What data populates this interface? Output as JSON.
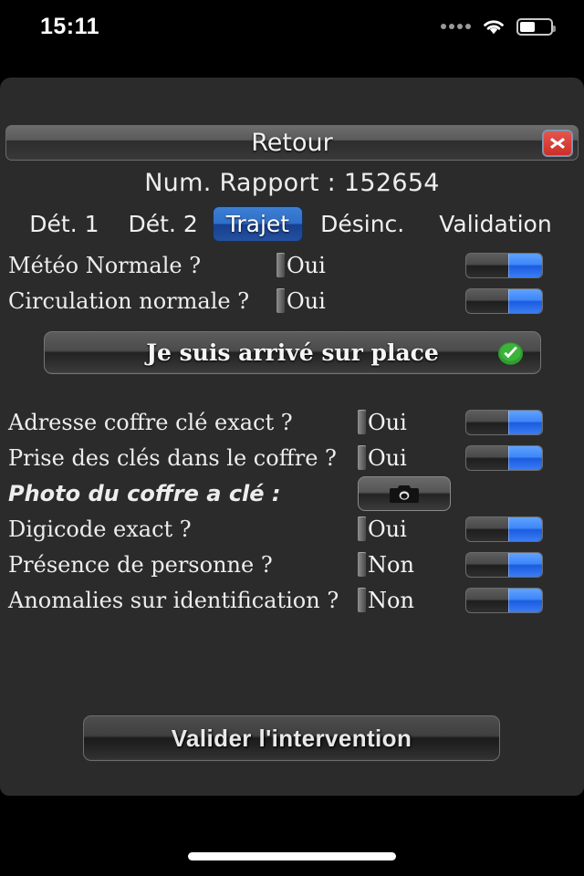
{
  "statusbar": {
    "time": "15:11",
    "signal_icon": "signal-dots-icon",
    "wifi_icon": "wifi-icon",
    "battery_icon": "battery-icon"
  },
  "header": {
    "back_label": "Retour",
    "close_icon": "close-x-icon",
    "report_label": "Num. Rapport : 152654"
  },
  "tabs": [
    {
      "label": "Dét. 1",
      "active": false
    },
    {
      "label": "Dét. 2",
      "active": false
    },
    {
      "label": "Trajet",
      "active": true
    },
    {
      "label": "Désinc.",
      "active": false
    },
    {
      "label": "Validation",
      "active": false
    }
  ],
  "form": {
    "group_top": [
      {
        "label": "Météo Normale ?",
        "value": "Oui",
        "toggle": "on"
      },
      {
        "label": "Circulation normale ?",
        "value": "Oui",
        "toggle": "on"
      }
    ],
    "arrive_button": {
      "label": "Je suis arrivé sur place",
      "icon": "green-check-icon"
    },
    "group_bottom": [
      {
        "label": "Adresse coffre clé exact ?",
        "value": "Oui",
        "toggle": "on"
      },
      {
        "label": "Prise des clés dans le coffre  ?",
        "value": "Oui",
        "toggle": "on"
      },
      {
        "label": "Photo du coffre a clé :",
        "value": "",
        "toggle": "none",
        "camera_icon": "camera-icon"
      },
      {
        "label": "Digicode exact  ?",
        "value": "Oui",
        "toggle": "on"
      },
      {
        "label": "Présence de personne ?",
        "value": "Non",
        "toggle": "on"
      },
      {
        "label": "Anomalies sur identification ?",
        "value": "Non",
        "toggle": "on"
      }
    ]
  },
  "footer": {
    "validate_label": "Valider l'intervention"
  },
  "colors": {
    "panel_bg": "#2b2b2b",
    "screen_bg": "#000000",
    "accent_blue": "#3f86f8",
    "tab_active_blue": "#2f6fc8",
    "close_red": "#cc2e28",
    "check_green": "#2f9e2f",
    "text": "#ededed"
  }
}
